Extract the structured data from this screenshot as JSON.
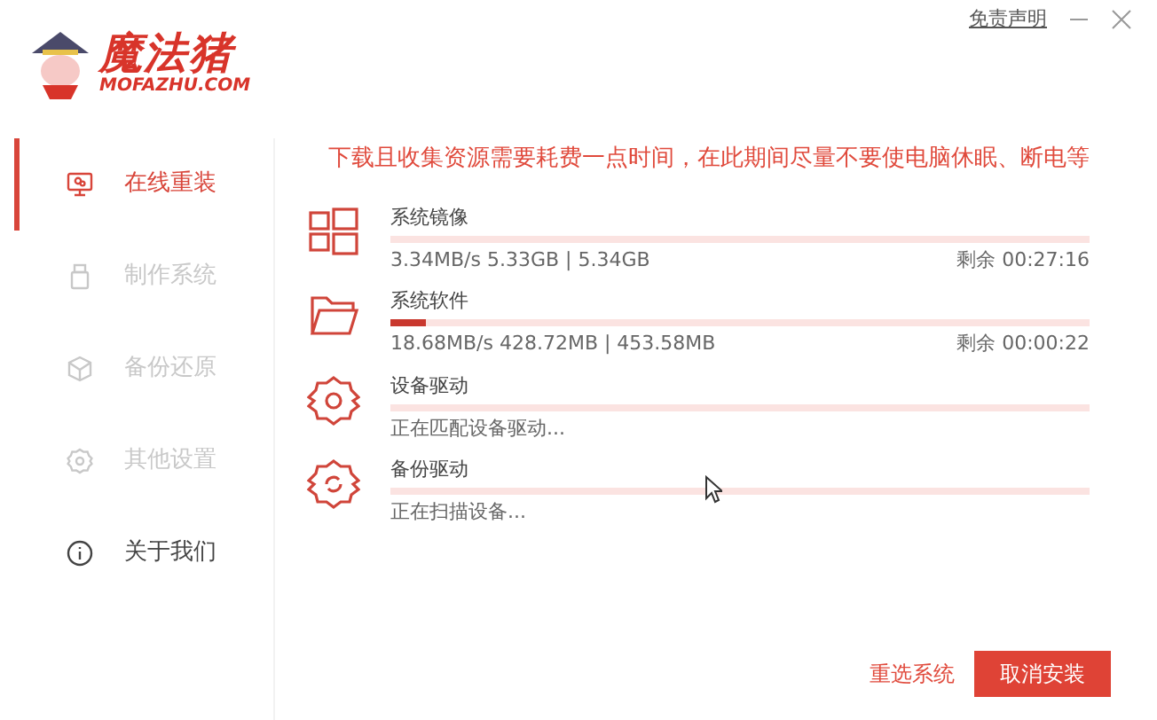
{
  "window": {
    "disclaimer_link": "免责声明"
  },
  "logo": {
    "name": "魔法猪",
    "domain": "MOFAZHU.COM"
  },
  "sidebar": {
    "items": [
      {
        "label": "在线重装",
        "kind": "monitor",
        "selected": true,
        "disabled": false
      },
      {
        "label": "制作系统",
        "kind": "usb",
        "selected": false,
        "disabled": true
      },
      {
        "label": "备份还原",
        "kind": "cube",
        "selected": false,
        "disabled": true
      },
      {
        "label": "其他设置",
        "kind": "gear",
        "selected": false,
        "disabled": true
      },
      {
        "label": "关于我们",
        "kind": "info",
        "selected": false,
        "disabled": false
      }
    ]
  },
  "notice": "下载且收集资源需要耗费一点时间，在此期间尽量不要使电脑休眠、断电等",
  "tasks": [
    {
      "kind": "windows",
      "title": "系统镜像",
      "detail": "3.34MB/s 5.33GB | 5.34GB",
      "remaining": "剩余 00:27:16"
    },
    {
      "kind": "folder",
      "title": "系统软件",
      "level": 0.05,
      "detail": "18.68MB/s 428.72MB | 453.58MB",
      "remaining": "剩余 00:00:22"
    },
    {
      "kind": "gear",
      "title": "设备驱动",
      "detail": "正在匹配设备驱动..."
    },
    {
      "kind": "gear-sync",
      "title": "备份驱动",
      "detail": "正在扫描设备..."
    }
  ],
  "buttons": {
    "reselect": "重选系统",
    "cancel": "取消安装"
  }
}
